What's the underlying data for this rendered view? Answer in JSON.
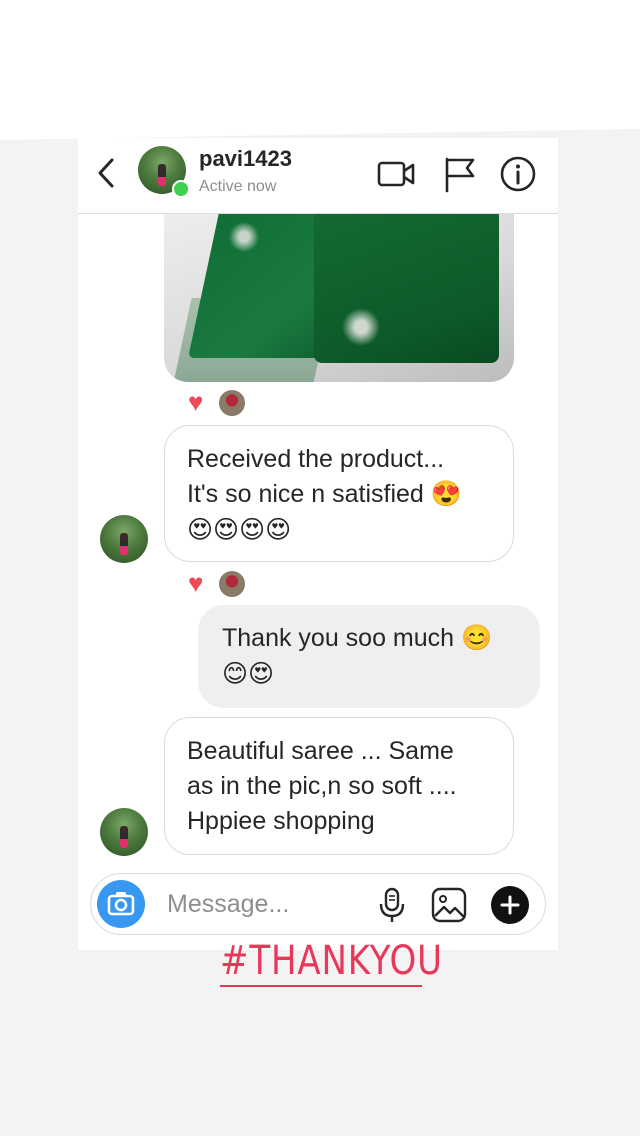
{
  "header": {
    "username": "pavi1423",
    "status": "Active now"
  },
  "messages": [
    {
      "type": "image",
      "description": "green saree photo",
      "reaction": "heart"
    },
    {
      "type": "received",
      "lines": [
        "Received the product...",
        "It's so nice n satisfied 😍",
        "😍😍😍😍"
      ],
      "reaction": "heart"
    },
    {
      "type": "sent",
      "lines": [
        "Thank you soo much 😊",
        "😊😍"
      ]
    },
    {
      "type": "received",
      "lines": [
        "Beautiful saree ... Same",
        "as in the pic,n so soft ....",
        "Hppiee shopping"
      ]
    }
  ],
  "composer": {
    "placeholder": "Message..."
  },
  "caption": "#THANKYOU",
  "colors": {
    "online": "#3ecf4f",
    "heart": "#ed4956",
    "camera": "#3897f0",
    "caption": "#e8385a"
  }
}
